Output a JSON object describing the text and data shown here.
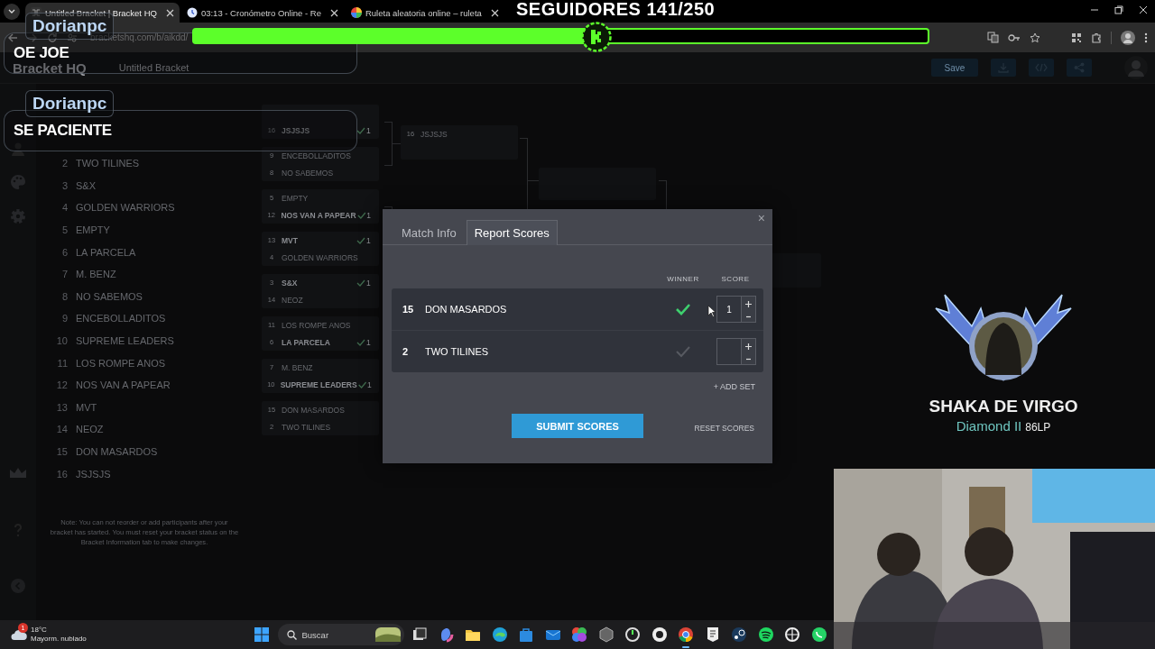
{
  "browser": {
    "tabs": [
      {
        "title": "Untitled Bracket | Bracket HQ",
        "selected": true
      },
      {
        "title": "03:13 - Cronómetro Online - Re",
        "selected": false
      },
      {
        "title": "Ruleta aleatoria online – ruleta",
        "selected": false
      }
    ],
    "url": "bracketshq.com/b/aikdd/"
  },
  "app": {
    "logo": "Bracket HQ",
    "bracket_title": "Untitled Bracket",
    "save_button": "Save"
  },
  "participants": [
    {
      "seed": "2",
      "name": "TWO TILINES"
    },
    {
      "seed": "3",
      "name": "S&X"
    },
    {
      "seed": "4",
      "name": "GOLDEN WARRIORS"
    },
    {
      "seed": "5",
      "name": "EMPTY"
    },
    {
      "seed": "6",
      "name": "LA PARCELA"
    },
    {
      "seed": "7",
      "name": "M. BENZ"
    },
    {
      "seed": "8",
      "name": "NO SABEMOS"
    },
    {
      "seed": "9",
      "name": "ENCEBOLLADITOS"
    },
    {
      "seed": "10",
      "name": "SUPREME LEADERS"
    },
    {
      "seed": "11",
      "name": "LOS ROMPE ANOS"
    },
    {
      "seed": "12",
      "name": "NOS VAN A PAPEAR"
    },
    {
      "seed": "13",
      "name": "MVT"
    },
    {
      "seed": "14",
      "name": "NEOZ"
    },
    {
      "seed": "15",
      "name": "DON MASARDOS"
    },
    {
      "seed": "16",
      "name": "JSJSJS"
    }
  ],
  "participants_note": "Note: You can not reorder or add participants after your bracket has started. You must reset your bracket status on the Bracket Information tab to make changes.",
  "bracket": {
    "round_1": [
      {
        "rows": [
          {
            "seed": "16",
            "name": "JSJSJS",
            "winner": true,
            "score": "1"
          }
        ]
      },
      {
        "rows": [
          {
            "seed": "9",
            "name": "ENCEBOLLADITOS",
            "winner": false
          },
          {
            "seed": "8",
            "name": "NO SABEMOS",
            "winner": false
          }
        ]
      },
      {
        "rows": [
          {
            "seed": "5",
            "name": "EMPTY",
            "winner": false
          },
          {
            "seed": "12",
            "name": "NOS VAN A PAPEAR",
            "winner": true,
            "score": "1"
          }
        ]
      },
      {
        "rows": [
          {
            "seed": "13",
            "name": "MVT",
            "winner": true,
            "score": "1"
          },
          {
            "seed": "4",
            "name": "GOLDEN WARRIORS",
            "winner": false
          }
        ]
      },
      {
        "rows": [
          {
            "seed": "3",
            "name": "S&X",
            "winner": true,
            "score": "1"
          },
          {
            "seed": "14",
            "name": "NEOZ",
            "winner": false
          }
        ]
      },
      {
        "rows": [
          {
            "seed": "11",
            "name": "LOS ROMPE ANOS",
            "winner": false
          },
          {
            "seed": "6",
            "name": "LA PARCELA",
            "winner": true,
            "score": "1"
          }
        ]
      },
      {
        "rows": [
          {
            "seed": "7",
            "name": "M. BENZ",
            "winner": false
          },
          {
            "seed": "10",
            "name": "SUPREME LEADERS",
            "winner": true,
            "score": "1"
          }
        ]
      },
      {
        "rows": [
          {
            "seed": "15",
            "name": "DON MASARDOS",
            "winner": false
          },
          {
            "seed": "2",
            "name": "TWO TILINES",
            "winner": false
          }
        ]
      }
    ],
    "round_2": [
      {
        "seed": "16",
        "name": "JSJSJS"
      }
    ]
  },
  "modal": {
    "tabs": [
      {
        "label": "Match Info",
        "selected": false
      },
      {
        "label": "Report Scores",
        "selected": true
      }
    ],
    "close": "×",
    "columns": [
      "WINNER",
      "SCORE"
    ],
    "rows": [
      {
        "seed": "15",
        "name": "DON MASARDOS",
        "winner": true,
        "score": "1"
      },
      {
        "seed": "2",
        "name": "TWO TILINES",
        "winner": false
      }
    ],
    "add_set": "+ ADD SET",
    "submit": "SUBMIT SCORES",
    "reset": "RESET SCORES"
  },
  "overlay": {
    "chat": [
      {
        "user": "Dorianpc",
        "message": "OE JOE"
      },
      {
        "user": "Dorianpc",
        "message": "SE PACIENTE"
      }
    ],
    "goal": {
      "label": "SEGUIDORES 141/250",
      "level": 0.54
    },
    "rank": {
      "name": "SHAKA DE VIRGO",
      "tier": "Diamond II",
      "points": "86LP"
    }
  },
  "taskbar": {
    "weather": {
      "badge": "1",
      "temperature": "18°C",
      "condition": "Mayorm. nublado"
    },
    "search_placeholder": "Buscar"
  }
}
